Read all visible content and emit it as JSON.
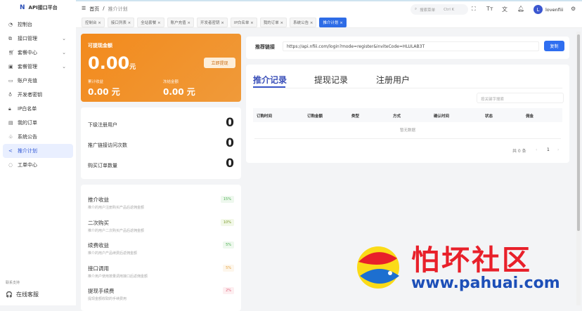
{
  "app": {
    "title": "API接口平台"
  },
  "sidebar": {
    "items": [
      {
        "label": "控制台",
        "icon": "dashboard-icon"
      },
      {
        "label": "接口管理",
        "icon": "api-icon",
        "expand": true
      },
      {
        "label": "套餐中心",
        "icon": "cart-icon",
        "expand": true
      },
      {
        "label": "套餐管理",
        "icon": "package-icon",
        "expand": true
      },
      {
        "label": "账户充值",
        "icon": "folder-icon"
      },
      {
        "label": "开发者密钥",
        "icon": "key-icon"
      },
      {
        "label": "IP白名单",
        "icon": "lock-icon"
      },
      {
        "label": "我的订单",
        "icon": "order-icon"
      },
      {
        "label": "系统公告",
        "icon": "bell-icon"
      },
      {
        "label": "推介计划",
        "icon": "share-icon",
        "active": true
      },
      {
        "label": "工单中心",
        "icon": "ticket-icon"
      }
    ],
    "support_label": "联系支持",
    "online_label": "在线客服"
  },
  "header": {
    "breadcrumb": [
      "首页",
      "推介计划"
    ],
    "search_placeholder": "搜索菜单",
    "search_shortcut": "Ctrl K",
    "user_initial": "L",
    "username": "lovenfiii"
  },
  "tabs": [
    "控制台",
    "接口列表",
    "全站套餐",
    "账户充值",
    "开发者密钥",
    "IP白名单",
    "我的订单",
    "系统公告",
    "推介计划"
  ],
  "balance": {
    "title": "可提现金额",
    "amount": "0.00",
    "unit": "元",
    "withdraw_button": "立即提现",
    "total_label": "累计收益",
    "total_value": "0.00 元",
    "frozen_label": "冻结金额",
    "frozen_value": "0.00 元"
  },
  "stats": [
    {
      "label": "下级注册用户",
      "value": "0"
    },
    {
      "label": "推广链接访问次数",
      "value": "0"
    },
    {
      "label": "购买订单数量",
      "value": "0"
    }
  ],
  "rates": [
    {
      "title": "推介收益",
      "desc": "推介的用户注册购买产品后返佣金额",
      "rate": "15%",
      "color": "#4caf50",
      "bg": "#eef8ee"
    },
    {
      "title": "二次购买",
      "desc": "推介的用户二次购买产品后返佣金额",
      "rate": "10%",
      "color": "#7a9a2a",
      "bg": "#f2f8e8"
    },
    {
      "title": "续费收益",
      "desc": "推介的用户产品续费后返佣金额",
      "rate": "5%",
      "color": "#4caf50",
      "bg": "#eef8ee"
    },
    {
      "title": "接口调用",
      "desc": "推介用户使用按量调用接口后返佣金额",
      "rate": "5%",
      "color": "#e6a23c",
      "bg": "#fdf6ec"
    },
    {
      "title": "提现手续费",
      "desc": "提现金额收取的手续费用",
      "rate": "2%",
      "color": "#e0607a",
      "bg": "#fdeef0"
    }
  ],
  "referral": {
    "label": "推荐链接",
    "url": "https://api.nfiii.com/login?mode=register&inviteCode=HLULAB3T",
    "copy_button": "复制"
  },
  "records": {
    "tabs": [
      "推介记录",
      "提现记录",
      "注册用户"
    ],
    "search_placeholder": "按关键字搜索",
    "columns": [
      "订购时间",
      "订购金额",
      "类型",
      "方式",
      "确认时间",
      "状态",
      "佣金"
    ],
    "empty": "暂无数据",
    "total": "共 0 条",
    "page": "1"
  },
  "watermark": {
    "cn": "怕坏社区",
    "url": "www.pahuai.com"
  }
}
